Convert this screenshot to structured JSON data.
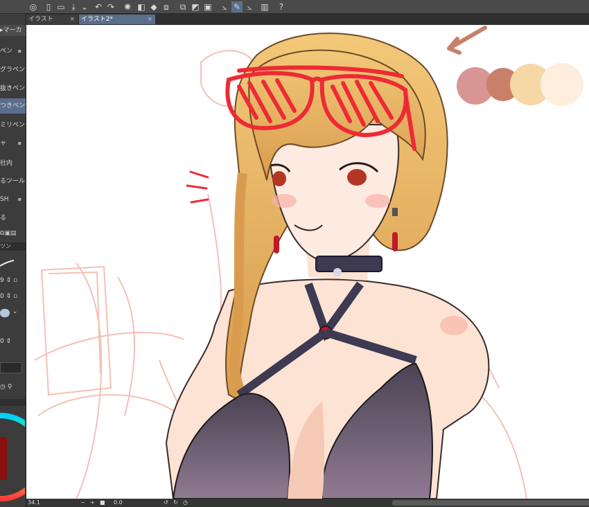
{
  "toolbar": {
    "icons": [
      "app-icon",
      "new-icon",
      "open-icon",
      "save-icon",
      "undo-icon",
      "redo-icon",
      "spinner-icon",
      "fill-icon",
      "transform-icon",
      "crop-icon",
      "select-icon",
      "pen-icon",
      "ruler-icon",
      "device-icon",
      "help-icon"
    ]
  },
  "tabs": [
    {
      "label": "イラスト",
      "close": "×"
    },
    {
      "label": "イラスト2*",
      "close": "×"
    }
  ],
  "left_panel": {
    "header": "マーカ",
    "sub_tools": [
      {
        "label": "ペン",
        "locked": true
      },
      {
        "label": "グラペン",
        "locked": false
      },
      {
        "label": "抜きペン",
        "locked": false
      },
      {
        "label": "つきペン",
        "locked": false,
        "active": true
      },
      {
        "label": "ミリペン",
        "locked": false
      },
      {
        "label": "ャ",
        "locked": true
      },
      {
        "label": "社内",
        "locked": false
      },
      {
        "label": "るツール",
        "locked": false
      },
      {
        "label": "SH",
        "locked": true
      },
      {
        "label": "る",
        "locked": false
      }
    ],
    "panel_label": "ツン",
    "size_values": [
      "9",
      "0",
      "0"
    ]
  },
  "colors": {
    "accent_red": "#ee2a35",
    "palette": [
      "#d79594",
      "#c9806a",
      "#f6d8a6",
      "#fdeedd"
    ],
    "active_tab": "#5b6f8c"
  },
  "status": {
    "zoom": "34.1",
    "rotation": "0.0"
  }
}
